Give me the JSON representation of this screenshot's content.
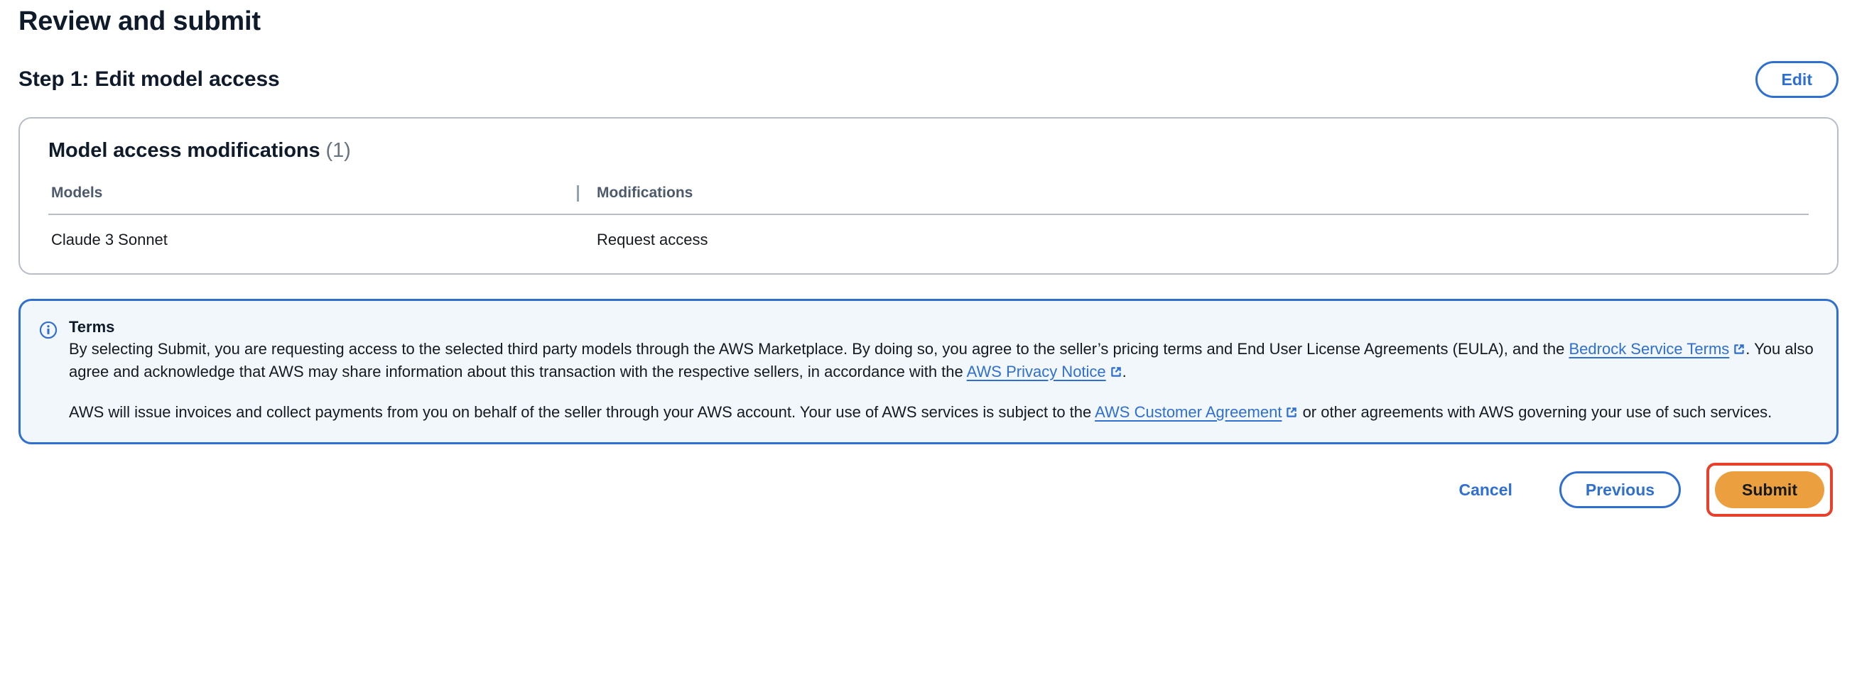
{
  "page": {
    "title": "Review and submit"
  },
  "step": {
    "title": "Step 1: Edit model access",
    "edit_label": "Edit"
  },
  "card": {
    "title": "Model access modifications",
    "count": "(1)",
    "table": {
      "columns": [
        "Models",
        "Modifications"
      ],
      "rows": [
        {
          "model": "Claude 3 Sonnet",
          "modification": "Request access"
        }
      ]
    }
  },
  "terms": {
    "icon": "info-circle-icon",
    "heading": "Terms",
    "paragraph1": {
      "part1": "By selecting Submit, you are requesting access to the selected third party models through the AWS Marketplace. By doing so, you agree to the seller’s pricing terms and End User License Agreements (EULA), and the ",
      "link1": "Bedrock Service Terms",
      "part2": ". You also agree and acknowledge that AWS may share information about this transaction with the respective sellers, in accordance with the ",
      "link2": "AWS Privacy Notice",
      "part3": "."
    },
    "paragraph2": {
      "part1": "AWS will issue invoices and collect payments from you on behalf of the seller through your AWS account. Your use of AWS services is subject to the ",
      "link1": "AWS Customer Agreement",
      "part2": " or other agreements with AWS governing your use of such services."
    }
  },
  "footer": {
    "cancel_label": "Cancel",
    "previous_label": "Previous",
    "submit_label": "Submit"
  },
  "colors": {
    "link_blue": "#2f6fd0",
    "primary_orange": "#eb9f3e",
    "alert_background": "#f2f7fc",
    "alert_border": "#2f6fd0",
    "card_border": "#b7bec9",
    "highlight_red": "#e8402a",
    "text_dark": "#16191f",
    "muted_text": "#68737f"
  }
}
